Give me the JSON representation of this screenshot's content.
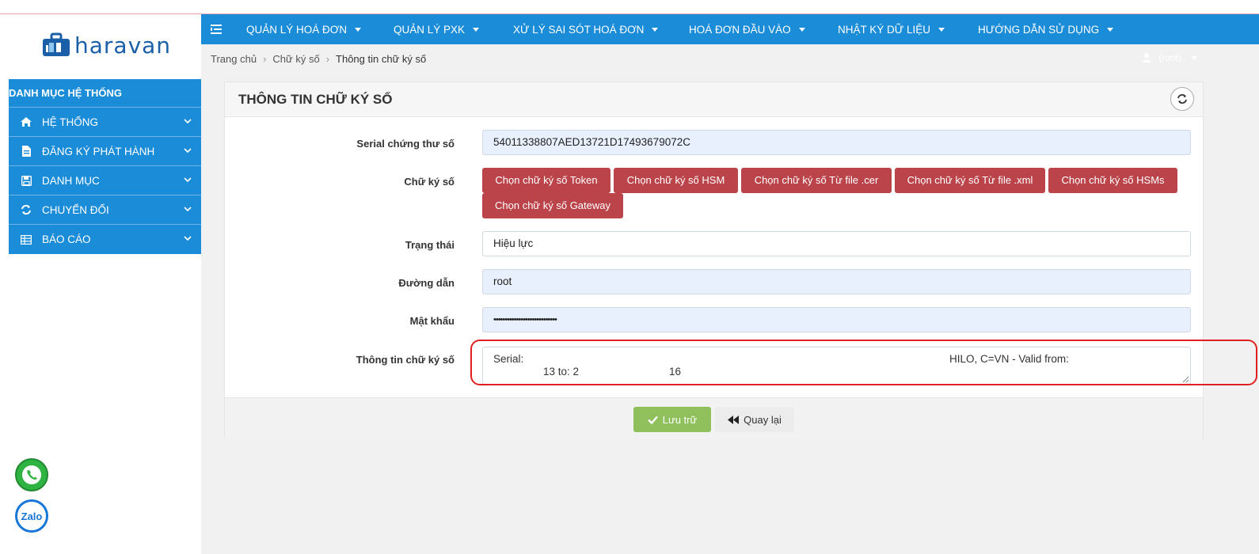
{
  "brand": {
    "name": "haravan"
  },
  "colors": {
    "primary": "#1a8cd8",
    "danger": "#bb444b",
    "success": "#8fc05c",
    "highlight": "#e0201e"
  },
  "topnav": {
    "items": [
      {
        "label": "QUẢN LÝ HOÁ ĐƠN"
      },
      {
        "label": "QUẢN LÝ PXK"
      },
      {
        "label": "XỬ LÝ SAI SÓT HOÁ ĐƠN"
      },
      {
        "label": "HOÁ ĐƠN ĐẦU VÀO"
      },
      {
        "label": "NHẬT KÝ DỮ LIỆU"
      },
      {
        "label": "HƯỚNG DẪN SỬ DỤNG"
      }
    ],
    "user": "(root)"
  },
  "breadcrumb": {
    "home": "Trang chủ",
    "parent": "Chữ ký số",
    "current": "Thông tin chữ ký số"
  },
  "sidebar": {
    "heading": "DANH MỤC HỆ THỐNG",
    "items": [
      {
        "label": "HỆ THỐNG",
        "icon": "home-icon"
      },
      {
        "label": "ĐĂNG KÝ PHÁT HÀNH",
        "icon": "file-icon"
      },
      {
        "label": "DANH MỤC",
        "icon": "save-icon"
      },
      {
        "label": "CHUYỂN ĐỔI",
        "icon": "refresh-icon"
      },
      {
        "label": "BÁO CÁO",
        "icon": "table-icon"
      }
    ]
  },
  "panel": {
    "title": "THÔNG TIN CHỮ KÝ SỐ",
    "serial": {
      "label": "Serial chứng thư số",
      "value": "54011338807AED13721D17493679072C"
    },
    "signature": {
      "label": "Chữ ký số",
      "buttons": [
        "Chọn chữ ký số Token",
        "Chọn chữ ký số HSM",
        "Chọn chữ ký số Từ file .cer",
        "Chọn chữ ký số Từ file .xml",
        "Chọn chữ ký số HSMs",
        "Chọn chữ ký số Gateway"
      ]
    },
    "status": {
      "label": "Trạng thái",
      "value": "Hiệu lực"
    },
    "path": {
      "label": "Đường dẫn",
      "value": "root"
    },
    "password": {
      "label": "Mật khẩu",
      "value": "••••••••••••••••••••••••••••"
    },
    "info": {
      "label": "Thông tin chữ ký số",
      "line1_a": "Serial:",
      "line1_b": "HILO, C=VN - Valid from:",
      "line2_a": "13 to: 2",
      "line2_b": "16"
    },
    "save_label": "Lưu trữ",
    "back_label": "Quay lại"
  },
  "floating": {
    "zalo_label": "Zalo"
  }
}
